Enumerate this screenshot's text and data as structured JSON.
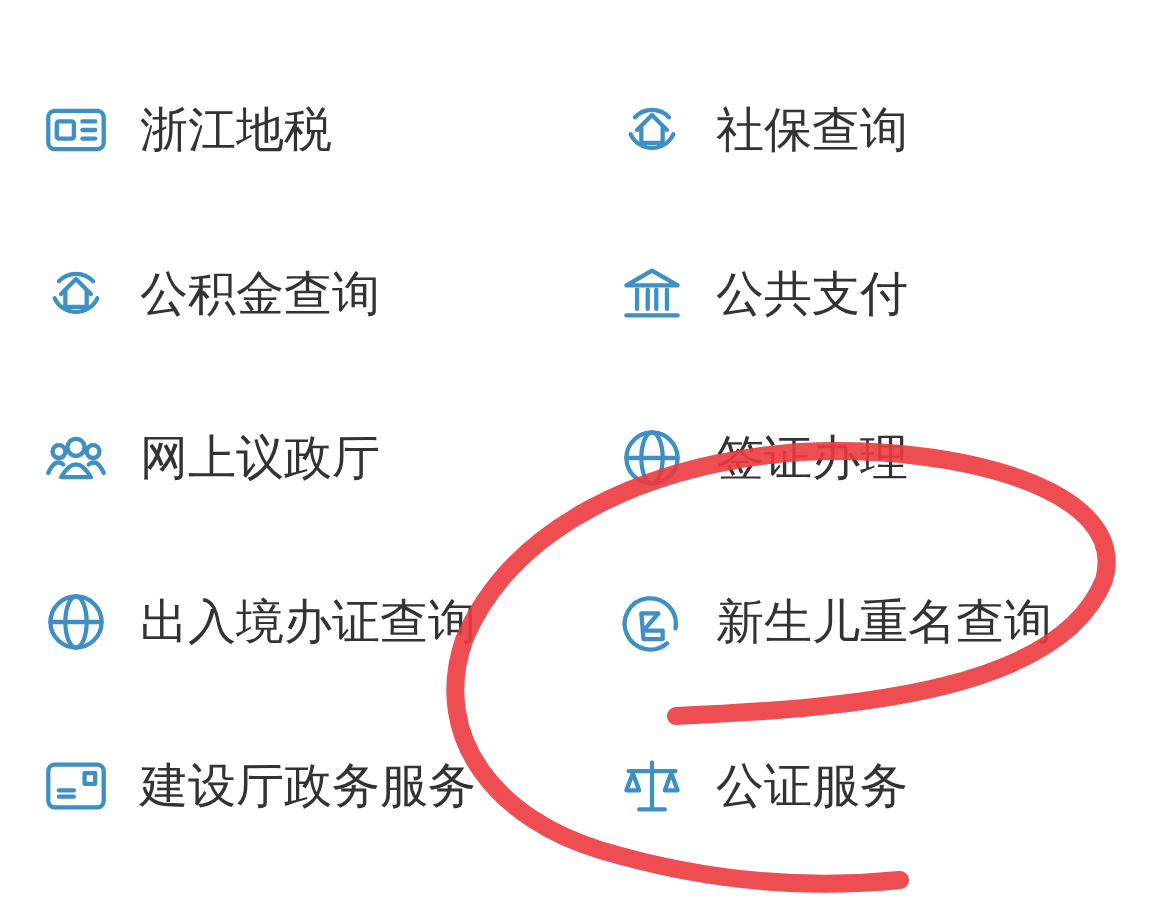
{
  "services": [
    {
      "label": "浙江地税",
      "kind": "tax"
    },
    {
      "label": "社保查询",
      "kind": "house"
    },
    {
      "label": "公积金查询",
      "kind": "house"
    },
    {
      "label": "公共支付",
      "kind": "bank"
    },
    {
      "label": "网上议政厅",
      "kind": "people"
    },
    {
      "label": "签证办理",
      "kind": "globe"
    },
    {
      "label": "出入境办证查询",
      "kind": "globe"
    },
    {
      "label": "新生儿重名查询",
      "kind": "name"
    },
    {
      "label": "建设厅政务服务",
      "kind": "card"
    },
    {
      "label": "公证服务",
      "kind": "scale"
    }
  ],
  "annotation": {
    "kind": "hand-drawn-loop"
  }
}
